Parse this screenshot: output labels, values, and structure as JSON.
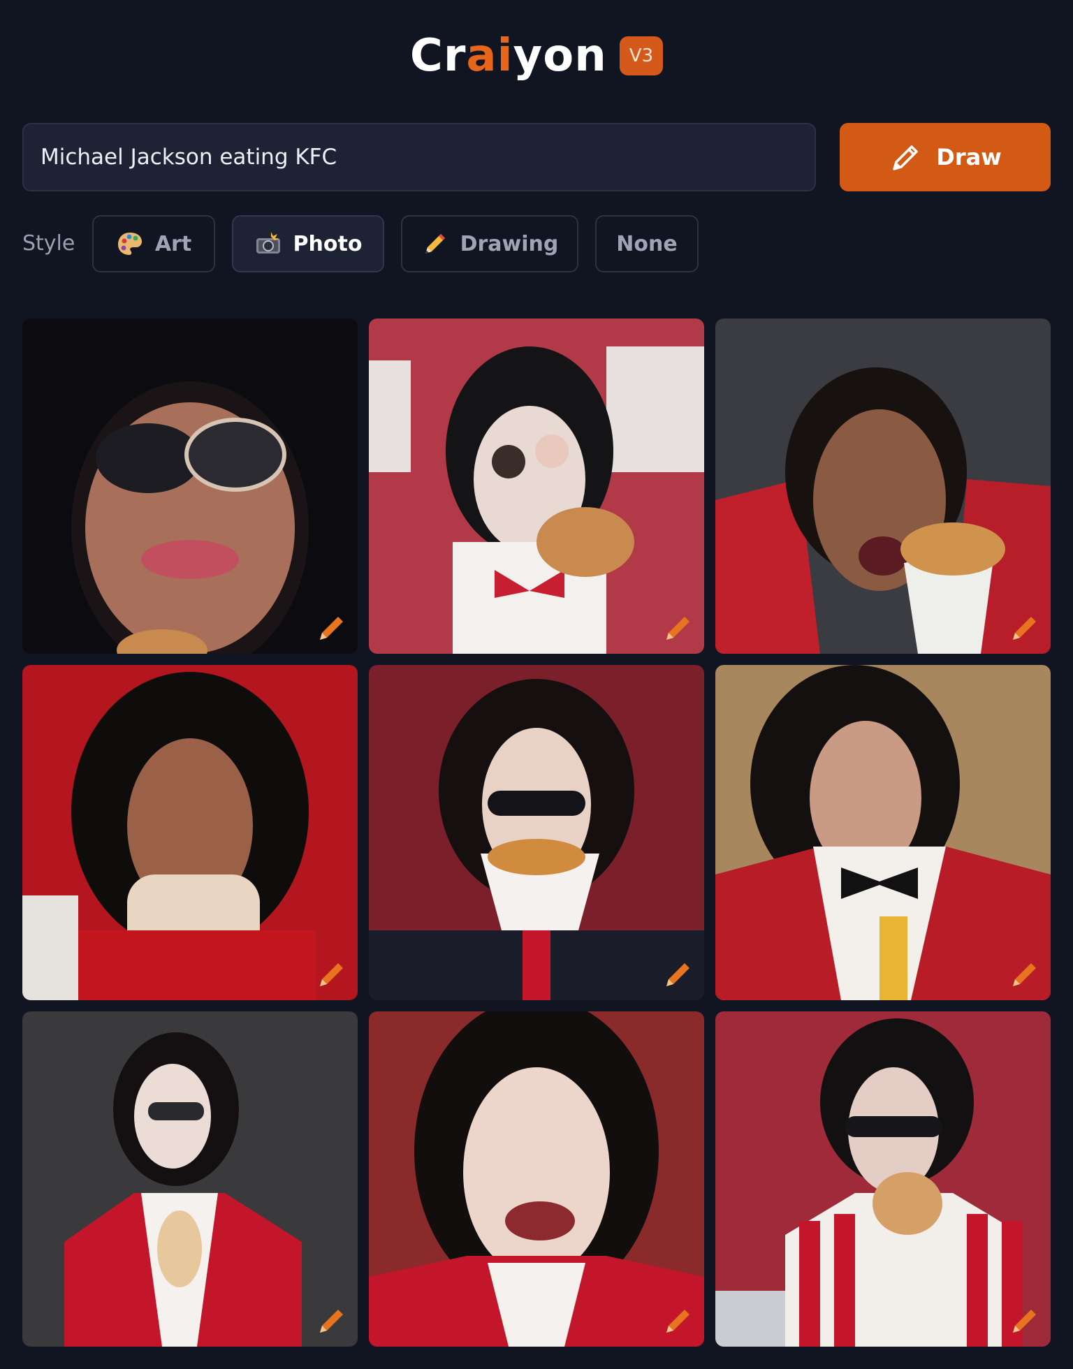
{
  "header": {
    "logo_part1": "Cr",
    "logo_accent": "ai",
    "logo_part2": "yon",
    "version": "V3"
  },
  "search": {
    "value": "Michael Jackson eating KFC",
    "draw_label": "Draw",
    "draw_icon": "pencil-icon"
  },
  "style": {
    "label": "Style",
    "options": [
      {
        "label": "Art",
        "icon": "palette-icon",
        "selected": false
      },
      {
        "label": "Photo",
        "icon": "camera-flash-icon",
        "selected": true
      },
      {
        "label": "Drawing",
        "icon": "pencil-icon",
        "selected": false
      },
      {
        "label": "None",
        "icon": "",
        "selected": false
      }
    ]
  },
  "results": {
    "count": 9,
    "edit_icon": "pencil-icon"
  },
  "colors": {
    "background": "#111521",
    "accent": "#d35a14",
    "input_bg": "#1d2234"
  }
}
